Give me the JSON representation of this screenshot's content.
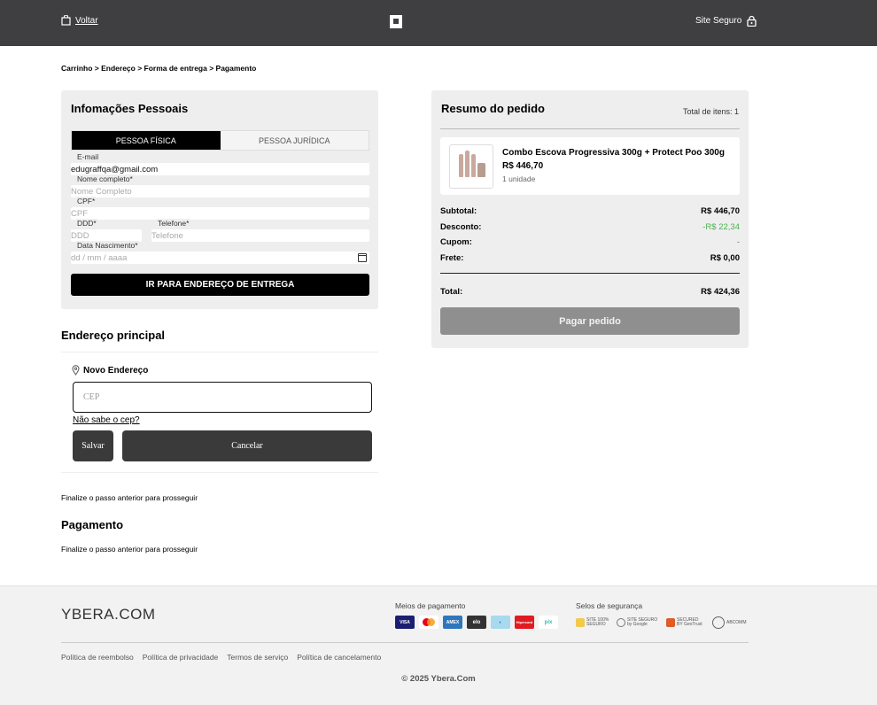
{
  "header": {
    "back_label": "Voltar",
    "secure_label": "Site Seguro"
  },
  "breadcrumb": "Carrinho > Endereço > Forma de entrega > Pagamento",
  "personal": {
    "title": "Infomações Pessoais",
    "tab_fisica": "PESSOA FÍSICA",
    "tab_juridica": "PESSOA JURÍDICA",
    "email_label": "E-mail",
    "email_value": "edugraffqa@gmail.com",
    "name_label": "Nome completo*",
    "name_placeholder": "Nome Completo",
    "cpf_label": "CPF*",
    "cpf_placeholder": "CPF",
    "ddd_label": "DDD*",
    "ddd_placeholder": "DDD",
    "phone_label": "Telefone*",
    "phone_placeholder": "Telefone",
    "birth_label": "Data Nascimento*",
    "birth_placeholder": "dd / mm / aaaa",
    "next_button": "IR PARA ENDEREÇO DE ENTREGA"
  },
  "address": {
    "title": "Endereço principal",
    "new_address": "Novo Endereço",
    "cep_placeholder": "CEP",
    "dont_know_cep": "Não sabe o cep?",
    "save_button": "Salvar",
    "cancel_button": "Cancelar"
  },
  "notes": {
    "step_note_1": "Finalize o passo anterior para prosseguir",
    "payment_title": "Pagamento",
    "step_note_2": "Finalize o passo anterior para prosseguir"
  },
  "summary": {
    "title": "Resumo do pedido",
    "total_items": "Total de itens: 1",
    "product_name": "Combo Escova Progressiva 300g + Protect Poo 300g",
    "product_price": "R$ 446,70",
    "product_qty": "1 unidade",
    "subtotal_label": "Subtotal:",
    "subtotal_value": "R$ 446,70",
    "discount_label": "Desconto:",
    "discount_value": "-R$ 22,34",
    "coupon_label": "Cupom:",
    "coupon_value": "-",
    "shipping_label": "Frete:",
    "shipping_value": "R$ 0,00",
    "total_label": "Total:",
    "total_value": "R$ 424,36",
    "pay_button": "Pagar pedido",
    "discount_color": "#4caf50"
  },
  "footer": {
    "brand": "YBERA.COM",
    "payments_title": "Meios de pagamento",
    "payment_icons": [
      "VISA",
      "",
      "AMEX",
      "elo",
      "",
      "Hipercard",
      "pix"
    ],
    "security_title": "Selos de segurança",
    "seals": [
      "SITE 100% SEGURO",
      "SITE SEGURO by Google",
      "SECURED BY GeoTrust",
      "ABCOMM"
    ],
    "links": [
      "Política de reembolso",
      "Política de privacidade",
      "Termos de serviço",
      "Política de cancelamento"
    ],
    "copyright": "© 2025 Ybera.Com"
  }
}
